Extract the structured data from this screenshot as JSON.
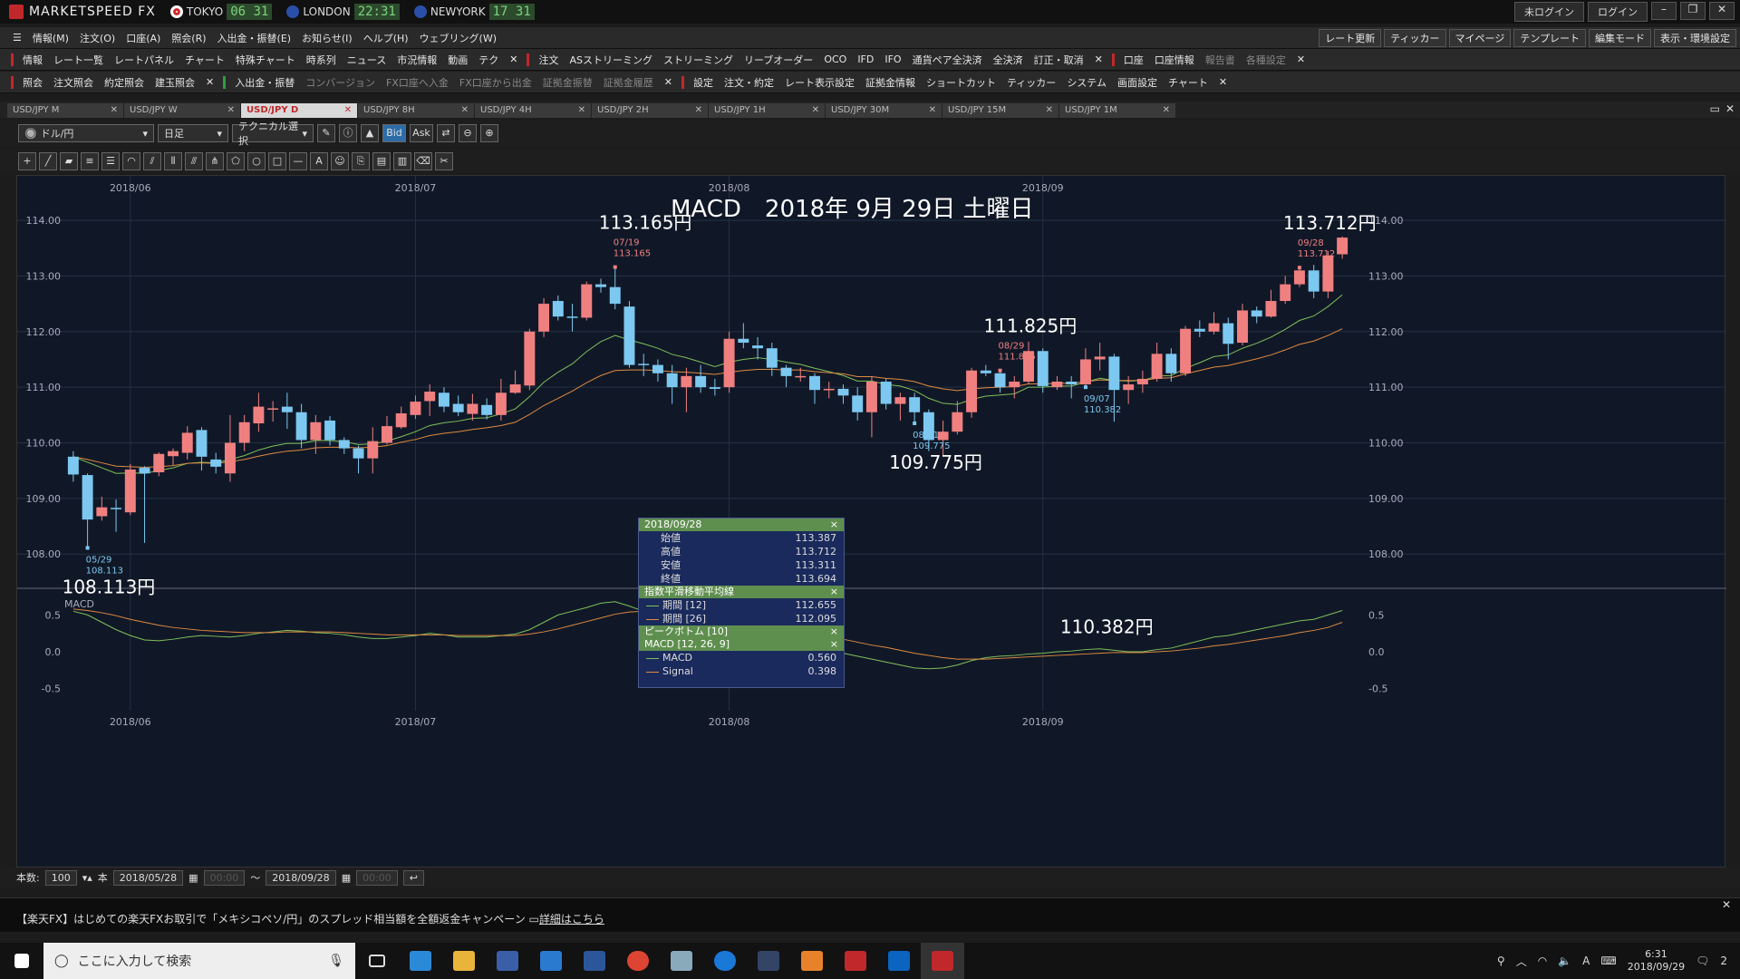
{
  "app": {
    "title": "MARKETSPEED FX",
    "clocks": [
      {
        "city": "TOKYO",
        "time": "06 31",
        "color": "#d12a2a"
      },
      {
        "city": "LONDON",
        "time": "22:31",
        "color": "#2a4fa8"
      },
      {
        "city": "NEWYORK",
        "time": "17 31",
        "color": "#2a4fa8"
      }
    ],
    "login_status": "未ログイン",
    "login_button": "ログイン"
  },
  "menu_bar": {
    "items": [
      "情報(M)",
      "注文(O)",
      "口座(A)",
      "照会(R)",
      "入出金・振替(E)",
      "お知らせ(I)",
      "ヘルプ(H)",
      "ウェブリング(W)"
    ],
    "right_buttons": [
      "レート更新",
      "ティッカー",
      "マイページ",
      "テンプレート",
      "編集モード",
      "表示・環境設定"
    ]
  },
  "toolbar_info": {
    "group1_label": "情報",
    "group1_items": [
      "レート一覧",
      "レートパネル",
      "チャート",
      "特殊チャート",
      "時系列",
      "ニュース",
      "市況情報",
      "動画",
      "テク"
    ],
    "group2_label": "注文",
    "group2_items": [
      "ASストリーミング",
      "ストリーミング",
      "リーブオーダー",
      "OCO",
      "IFD",
      "IFO",
      "通貨ペア全決済",
      "全決済",
      "訂正・取消"
    ],
    "group3_label": "口座",
    "group3_items": [
      "口座情報",
      "報告書",
      "各種設定"
    ]
  },
  "toolbar_account": {
    "group1_label": "照会",
    "group1_items": [
      "注文照会",
      "約定照会",
      "建玉照会"
    ],
    "group2_label": "入出金・振替",
    "group2_items": [
      "コンバージョン",
      "FX口座へ入金",
      "FX口座から出金",
      "証拠金振替",
      "証拠金履歴"
    ],
    "group3_label": "設定",
    "group3_items": [
      "注文・約定",
      "レート表示設定",
      "証拠金情報",
      "ショートカット",
      "ティッカー",
      "システム",
      "画面設定",
      "チャート"
    ]
  },
  "tabs": [
    "USD/JPY M",
    "USD/JPY W",
    "USD/JPY D",
    "USD/JPY 8H",
    "USD/JPY 4H",
    "USD/JPY 2H",
    "USD/JPY 1H",
    "USD/JPY 30M",
    "USD/JPY 15M",
    "USD/JPY 1M"
  ],
  "active_tab": 2,
  "chart_toolbar": {
    "pair": "ドル/円",
    "period": "日足",
    "technical": "テクニカル選択",
    "bid": "Bid",
    "ask": "Ask"
  },
  "chart_data": {
    "type": "candlestick",
    "title": "MACD　2018年 9月 29日 土曜日",
    "y_ticks": [
      "114.00",
      "113.00",
      "112.00",
      "111.00",
      "110.00",
      "109.00",
      "108.00"
    ],
    "ylim": [
      107.4,
      114.8
    ],
    "x_ticks": [
      "2018/06",
      "2018/07",
      "2018/08",
      "2018/09"
    ],
    "x_tick_index": [
      4,
      24,
      46,
      68
    ],
    "macd_label": "MACD",
    "macd_y_ticks": [
      "0.5",
      "0.0",
      "-0.5"
    ],
    "macd_ylim": [
      -0.8,
      0.8
    ],
    "annotations": [
      {
        "idx": 1,
        "kind": "low",
        "price": "108.113",
        "date": "05/29",
        "big": "108.113円"
      },
      {
        "idx": 38,
        "kind": "high",
        "price": "113.165",
        "date": "07/19",
        "big": "113.165円"
      },
      {
        "idx": 59,
        "kind": "low",
        "price": "109.775",
        "date": "08/21",
        "big": "109.775円"
      },
      {
        "idx": 65,
        "kind": "high",
        "price": "111.825",
        "date": "08/29",
        "big": "111.825円"
      },
      {
        "idx": 71,
        "kind": "low",
        "price": "110.382",
        "date": "09/07",
        "big": "110.382円"
      },
      {
        "idx": 86,
        "kind": "high",
        "price": "113.712",
        "date": "09/28",
        "big": "113.712円"
      }
    ],
    "candles": [
      [
        109.75,
        109.43,
        109.85,
        109.3
      ],
      [
        109.42,
        108.62,
        109.45,
        108.11
      ],
      [
        108.68,
        108.84,
        109.03,
        108.6
      ],
      [
        108.83,
        108.81,
        108.98,
        108.4
      ],
      [
        108.75,
        109.52,
        109.62,
        108.7
      ],
      [
        109.55,
        109.45,
        109.58,
        108.2
      ],
      [
        109.47,
        109.8,
        109.83,
        109.4
      ],
      [
        109.76,
        109.85,
        109.9,
        109.6
      ],
      [
        109.82,
        110.18,
        110.3,
        109.7
      ],
      [
        110.23,
        109.75,
        110.28,
        109.5
      ],
      [
        109.7,
        109.57,
        109.82,
        109.45
      ],
      [
        109.45,
        110.0,
        110.5,
        109.3
      ],
      [
        110.0,
        110.37,
        110.5,
        109.85
      ],
      [
        110.35,
        110.65,
        110.9,
        110.2
      ],
      [
        110.6,
        110.62,
        110.75,
        110.38
      ],
      [
        110.65,
        110.55,
        110.9,
        110.25
      ],
      [
        110.55,
        110.05,
        110.7,
        109.9
      ],
      [
        110.05,
        110.37,
        110.5,
        109.8
      ],
      [
        110.4,
        110.05,
        110.48,
        109.95
      ],
      [
        110.05,
        109.9,
        110.1,
        109.8
      ],
      [
        109.9,
        109.72,
        109.95,
        109.45
      ],
      [
        109.72,
        110.03,
        110.28,
        109.45
      ],
      [
        110.0,
        110.3,
        110.48,
        109.97
      ],
      [
        110.28,
        110.53,
        110.65,
        110.25
      ],
      [
        110.5,
        110.74,
        110.85,
        110.43
      ],
      [
        110.75,
        110.92,
        111.05,
        110.48
      ],
      [
        110.9,
        110.65,
        111.0,
        110.55
      ],
      [
        110.7,
        110.55,
        110.85,
        110.48
      ],
      [
        110.52,
        110.7,
        110.88,
        110.4
      ],
      [
        110.68,
        110.5,
        110.8,
        110.42
      ],
      [
        110.5,
        110.9,
        111.15,
        110.4
      ],
      [
        110.9,
        111.05,
        111.3,
        110.88
      ],
      [
        111.03,
        112.0,
        112.05,
        110.95
      ],
      [
        112.0,
        112.5,
        112.6,
        111.9
      ],
      [
        112.55,
        112.27,
        112.65,
        112.2
      ],
      [
        112.27,
        112.25,
        112.5,
        112.0
      ],
      [
        112.25,
        112.85,
        112.9,
        112.2
      ],
      [
        112.85,
        112.8,
        112.95,
        112.7
      ],
      [
        112.8,
        112.5,
        113.16,
        112.4
      ],
      [
        112.45,
        111.4,
        112.55,
        111.35
      ],
      [
        111.42,
        111.4,
        111.6,
        111.2
      ],
      [
        111.4,
        111.25,
        111.5,
        111.1
      ],
      [
        111.25,
        111.0,
        111.4,
        110.7
      ],
      [
        111.0,
        111.2,
        111.35,
        110.55
      ],
      [
        111.2,
        111.0,
        111.4,
        110.9
      ],
      [
        111.0,
        110.97,
        111.15,
        110.85
      ],
      [
        111.0,
        111.87,
        112.0,
        110.9
      ],
      [
        111.87,
        111.8,
        112.15,
        111.7
      ],
      [
        111.75,
        111.7,
        111.9,
        111.5
      ],
      [
        111.7,
        111.35,
        111.8,
        111.2
      ],
      [
        111.35,
        111.2,
        111.4,
        111.0
      ],
      [
        111.2,
        111.2,
        111.35,
        111.1
      ],
      [
        111.2,
        110.95,
        111.25,
        110.7
      ],
      [
        110.95,
        110.97,
        111.1,
        110.8
      ],
      [
        110.97,
        110.85,
        111.05,
        110.7
      ],
      [
        110.85,
        110.55,
        111.0,
        110.4
      ],
      [
        110.55,
        111.1,
        111.2,
        110.1
      ],
      [
        111.1,
        110.7,
        111.15,
        110.6
      ],
      [
        110.7,
        110.82,
        110.9,
        110.4
      ],
      [
        110.82,
        110.55,
        110.9,
        110.35
      ],
      [
        110.55,
        110.05,
        110.6,
        109.85
      ],
      [
        110.05,
        110.2,
        110.4,
        109.78
      ],
      [
        110.2,
        110.55,
        110.75,
        110.15
      ],
      [
        110.55,
        111.3,
        111.35,
        110.45
      ],
      [
        111.3,
        111.25,
        111.4,
        111.2
      ],
      [
        111.25,
        111.0,
        111.3,
        110.9
      ],
      [
        111.0,
        111.1,
        111.2,
        110.8
      ],
      [
        111.1,
        111.65,
        111.82,
        111.05
      ],
      [
        111.65,
        111.02,
        111.7,
        110.9
      ],
      [
        111.0,
        111.1,
        111.2,
        110.95
      ],
      [
        111.1,
        111.05,
        111.2,
        110.8
      ],
      [
        111.05,
        111.5,
        111.7,
        111.0
      ],
      [
        111.5,
        111.55,
        111.8,
        111.3
      ],
      [
        111.55,
        110.95,
        111.6,
        110.38
      ],
      [
        110.95,
        111.05,
        111.2,
        110.7
      ],
      [
        111.05,
        111.15,
        111.3,
        110.9
      ],
      [
        111.15,
        111.6,
        111.8,
        111.1
      ],
      [
        111.6,
        111.25,
        111.7,
        111.1
      ],
      [
        111.25,
        112.05,
        112.1,
        111.2
      ],
      [
        112.05,
        112.0,
        112.2,
        111.9
      ],
      [
        112.0,
        112.15,
        112.35,
        111.95
      ],
      [
        112.15,
        111.78,
        112.25,
        111.5
      ],
      [
        111.8,
        112.38,
        112.5,
        111.75
      ],
      [
        112.38,
        112.27,
        112.45,
        112.15
      ],
      [
        112.27,
        112.55,
        112.75,
        112.25
      ],
      [
        112.55,
        112.85,
        113.0,
        112.5
      ],
      [
        112.85,
        113.1,
        113.15,
        112.8
      ],
      [
        113.1,
        112.72,
        113.2,
        112.6
      ],
      [
        112.72,
        113.37,
        113.45,
        112.6
      ],
      [
        113.39,
        113.69,
        113.71,
        113.31
      ]
    ],
    "series": [
      {
        "name": "期間 [12]",
        "color": "#7fbf5a",
        "values": [
          109.75,
          109.65,
          109.55,
          109.45,
          109.46,
          109.45,
          109.5,
          109.55,
          109.63,
          109.65,
          109.64,
          109.7,
          109.77,
          109.87,
          109.94,
          109.99,
          109.99,
          110.04,
          110.04,
          110.02,
          109.97,
          109.98,
          110.03,
          110.11,
          110.2,
          110.31,
          110.36,
          110.39,
          110.44,
          110.45,
          110.52,
          110.61,
          110.83,
          111.09,
          111.27,
          111.42,
          111.64,
          111.82,
          111.93,
          111.85,
          111.78,
          111.7,
          111.59,
          111.53,
          111.45,
          111.37,
          111.45,
          111.5,
          111.53,
          111.5,
          111.45,
          111.41,
          111.34,
          111.28,
          111.21,
          111.11,
          111.11,
          111.05,
          111.02,
          110.94,
          110.8,
          110.71,
          110.69,
          110.78,
          110.84,
          110.86,
          110.88,
          111.0,
          111.0,
          111.02,
          111.02,
          111.09,
          111.16,
          111.12,
          111.11,
          111.12,
          111.2,
          111.21,
          111.34,
          111.44,
          111.55,
          111.58,
          111.7,
          111.79,
          111.9,
          112.04,
          112.2,
          112.28,
          112.45,
          112.66
        ]
      },
      {
        "name": "期間 [26]",
        "color": "#e08a40",
        "values": [
          109.75,
          109.7,
          109.64,
          109.58,
          109.57,
          109.56,
          109.57,
          109.59,
          109.63,
          109.64,
          109.63,
          109.66,
          109.7,
          109.76,
          109.81,
          109.85,
          109.87,
          109.91,
          109.92,
          109.92,
          109.91,
          109.92,
          109.95,
          110.01,
          110.06,
          110.13,
          110.17,
          110.2,
          110.24,
          110.27,
          110.31,
          110.37,
          110.51,
          110.67,
          110.8,
          110.93,
          111.08,
          111.21,
          111.3,
          111.31,
          111.31,
          111.3,
          111.28,
          111.27,
          111.25,
          111.23,
          111.27,
          111.3,
          111.32,
          111.32,
          111.31,
          111.31,
          111.28,
          111.26,
          111.24,
          111.19,
          111.19,
          111.16,
          111.14,
          111.1,
          111.02,
          110.97,
          110.94,
          110.97,
          110.99,
          111.0,
          111.01,
          111.06,
          111.06,
          111.07,
          111.07,
          111.1,
          111.13,
          111.12,
          111.12,
          111.12,
          111.16,
          111.17,
          111.24,
          111.3,
          111.36,
          111.39,
          111.45,
          111.51,
          111.58,
          111.67,
          111.77,
          111.83,
          111.93,
          112.05
        ]
      }
    ],
    "macd": {
      "name": "MACD",
      "color": "#7fbf5a",
      "values": [
        0.55,
        0.5,
        0.4,
        0.3,
        0.22,
        0.16,
        0.15,
        0.17,
        0.2,
        0.22,
        0.21,
        0.2,
        0.22,
        0.25,
        0.27,
        0.29,
        0.28,
        0.26,
        0.25,
        0.23,
        0.2,
        0.18,
        0.18,
        0.2,
        0.22,
        0.25,
        0.23,
        0.2,
        0.2,
        0.2,
        0.22,
        0.24,
        0.3,
        0.4,
        0.5,
        0.55,
        0.6,
        0.66,
        0.68,
        0.62,
        0.55,
        0.48,
        0.42,
        0.36,
        0.3,
        0.25,
        0.22,
        0.2,
        0.18,
        0.15,
        0.12,
        0.1,
        0.06,
        0.02,
        -0.02,
        -0.06,
        -0.1,
        -0.14,
        -0.18,
        -0.22,
        -0.23,
        -0.22,
        -0.18,
        -0.12,
        -0.08,
        -0.06,
        -0.05,
        -0.03,
        -0.02,
        0.0,
        0.01,
        0.03,
        0.04,
        0.02,
        0.0,
        0.0,
        0.03,
        0.05,
        0.1,
        0.15,
        0.2,
        0.22,
        0.26,
        0.3,
        0.34,
        0.38,
        0.42,
        0.44,
        0.5,
        0.56
      ]
    },
    "signal": {
      "name": "Signal",
      "color": "#e08a40",
      "values": [
        0.58,
        0.56,
        0.53,
        0.49,
        0.44,
        0.4,
        0.36,
        0.33,
        0.31,
        0.29,
        0.28,
        0.27,
        0.26,
        0.26,
        0.26,
        0.27,
        0.27,
        0.27,
        0.27,
        0.26,
        0.25,
        0.24,
        0.23,
        0.23,
        0.23,
        0.23,
        0.23,
        0.22,
        0.22,
        0.22,
        0.22,
        0.22,
        0.24,
        0.27,
        0.31,
        0.36,
        0.41,
        0.46,
        0.51,
        0.54,
        0.55,
        0.55,
        0.54,
        0.52,
        0.49,
        0.46,
        0.42,
        0.39,
        0.36,
        0.33,
        0.3,
        0.27,
        0.24,
        0.2,
        0.17,
        0.13,
        0.09,
        0.06,
        0.02,
        -0.02,
        -0.05,
        -0.08,
        -0.1,
        -0.1,
        -0.1,
        -0.09,
        -0.08,
        -0.07,
        -0.06,
        -0.05,
        -0.04,
        -0.03,
        -0.02,
        -0.01,
        -0.01,
        -0.01,
        0.0,
        0.01,
        0.03,
        0.05,
        0.08,
        0.1,
        0.13,
        0.16,
        0.19,
        0.22,
        0.26,
        0.29,
        0.33,
        0.4
      ]
    }
  },
  "popup": {
    "date": "2018/09/28",
    "ohlc": [
      [
        "始値",
        "113.387"
      ],
      [
        "高値",
        "113.712"
      ],
      [
        "安値",
        "113.311"
      ],
      [
        "終値",
        "113.694"
      ]
    ],
    "ema_title": "指数平滑移動平均線",
    "ema": [
      [
        "期間 [12]",
        "112.655"
      ],
      [
        "期間 [26]",
        "112.095"
      ]
    ],
    "peak_title": "ピークボトム [10]",
    "macd_title": "MACD [12, 26, 9]",
    "macd": [
      [
        "MACD",
        "0.560"
      ],
      [
        "Signal",
        "0.398"
      ]
    ]
  },
  "status": {
    "count_label": "本数:",
    "count": "100",
    "unit": "本",
    "from": "2018/05/28",
    "to": "2018/09/28",
    "time_placeholder": "00:00",
    "tilde": "～"
  },
  "news": {
    "text": "【楽天FX】はじめての楽天FXお取引で「メキシコペソ/円」のスプレッド相当額を全額返金キャンペーン",
    "link": "詳細はこちら"
  },
  "taskbar": {
    "search_placeholder": "ここに入力して検索",
    "time": "6:31",
    "date": "2018/09/29",
    "notif_count": "2"
  }
}
